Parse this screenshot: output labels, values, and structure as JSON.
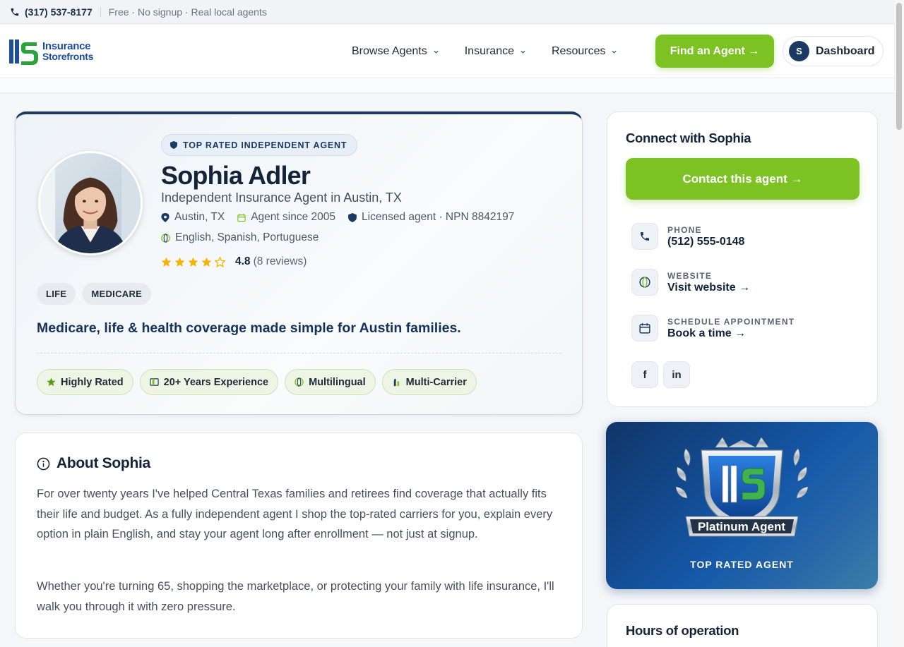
{
  "topbar": {
    "phone": "(317) 537-8177",
    "tagline": "Free · No signup · Real local agents"
  },
  "header": {
    "logo": {
      "line1": "Insurance",
      "line2": "Storefronts"
    },
    "nav": [
      {
        "label": "Browse Agents"
      },
      {
        "label": "Insurance"
      },
      {
        "label": "Resources"
      }
    ],
    "find_agent": "Find an Agent →",
    "dashboard": {
      "initial": "S",
      "label": "Dashboard"
    }
  },
  "profile": {
    "badge": "TOP RATED INDEPENDENT AGENT",
    "name": "Sophia Adler",
    "title": "Independent Insurance Agent in Austin, TX",
    "location": "Austin, TX",
    "since": "Agent since 2005",
    "license": "Licensed agent · NPN 8842197",
    "languages": "English, Spanish, Portuguese",
    "rating": 4.8,
    "rating_text": "4.8",
    "reviews": "(8 reviews)",
    "stars_filled": 4,
    "stars_total": 5,
    "specialties": [
      "LIFE",
      "MEDICARE"
    ],
    "tagline": "Medicare, life & health coverage made simple for Austin families.",
    "badges": [
      "Highly Rated",
      "20+ Years Experience",
      "Multilingual",
      "Multi-Carrier"
    ]
  },
  "about": {
    "title": "About Sophia",
    "p1": "For over twenty years I've helped Central Texas families and retirees find coverage that actually fits their life and budget. As a fully independent agent I shop the top-rated carriers for you, explain every option in plain English, and stay your agent long after enrollment — not just at signup.",
    "p2": "Whether you're turning 65, shopping the marketplace, or protecting your family with life insurance, I'll walk you through it with zero pressure."
  },
  "connect": {
    "title": "Connect with Sophia",
    "contact_button": "Contact this agent →",
    "phone_label": "PHONE",
    "phone_value": "(512) 555-0148",
    "website_label": "WEBSITE",
    "website_value": "Visit website →",
    "appt_label": "SCHEDULE APPOINTMENT",
    "appt_value": "Book a time →",
    "socials": [
      "f",
      "in"
    ]
  },
  "platinum": {
    "logo_text": "Platinum Agent",
    "caption": "TOP RATED AGENT"
  },
  "hours": {
    "title": "Hours of operation"
  },
  "colors": {
    "brand_green": "#7cc223",
    "brand_navy": "#1b3a63",
    "star": "#f5b400"
  }
}
